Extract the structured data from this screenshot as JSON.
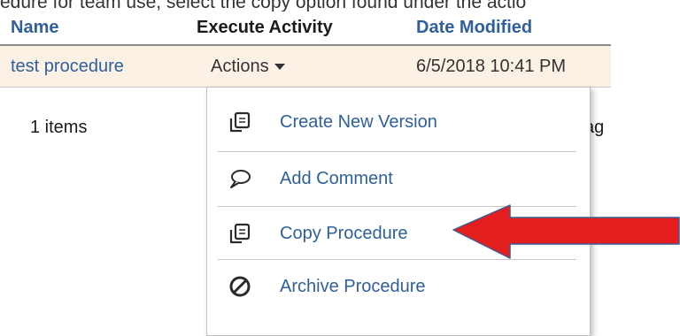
{
  "caption": "edure for team use, select the copy option found under the actio",
  "table": {
    "headers": {
      "name": "Name",
      "execute": "Execute Activity",
      "modified": "Date Modified"
    },
    "row": {
      "name": "test procedure",
      "actions": "Actions",
      "date": "6/5/2018 10:41 PM"
    },
    "footer": {
      "count": "1 items",
      "partial": "ag"
    }
  },
  "menu": {
    "items": [
      {
        "label": "Create New Version",
        "icon": "copy-icon"
      },
      {
        "label": "Add Comment",
        "icon": "comment-icon"
      },
      {
        "label": "Copy Procedure",
        "icon": "copy-icon"
      },
      {
        "label": "Archive Procedure",
        "icon": "ban-icon"
      }
    ]
  },
  "colors": {
    "link": "#2f5f9c",
    "row_highlight": "#fbf1e4",
    "arrow": "#e41e1e"
  }
}
